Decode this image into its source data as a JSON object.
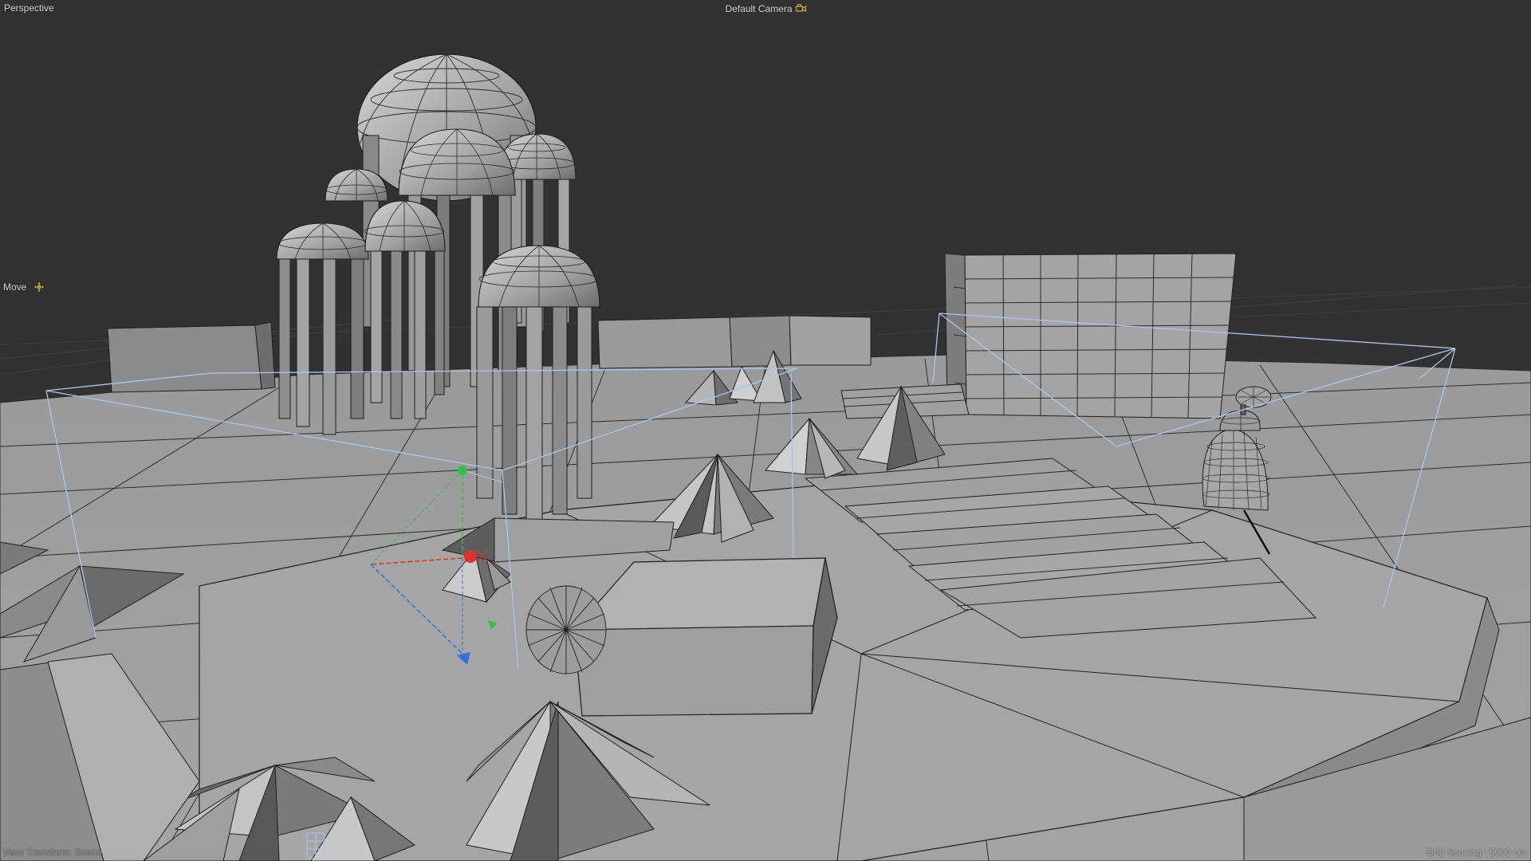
{
  "viewport": {
    "view_mode": "Perspective",
    "camera_name": "Default Camera",
    "active_tool": "Move",
    "view_transform": "View Transform: Scene",
    "grid_spacing": "Grid Spacing : 5000 cm"
  },
  "icons": {
    "camera": "camera-lock-icon",
    "move": "move-tool-icon"
  },
  "colors": {
    "background": "#323232",
    "ground": "#9b9b9b",
    "geometry": "#a6a6a6",
    "wire": "#1e1e1e",
    "selection_box": "#a9c8ea",
    "axis_x": "#e0302c",
    "axis_y": "#2fc24a",
    "axis_z": "#2f72e0",
    "hud_text": "#d8d8d8",
    "camera_icon": "#d7b24a"
  }
}
